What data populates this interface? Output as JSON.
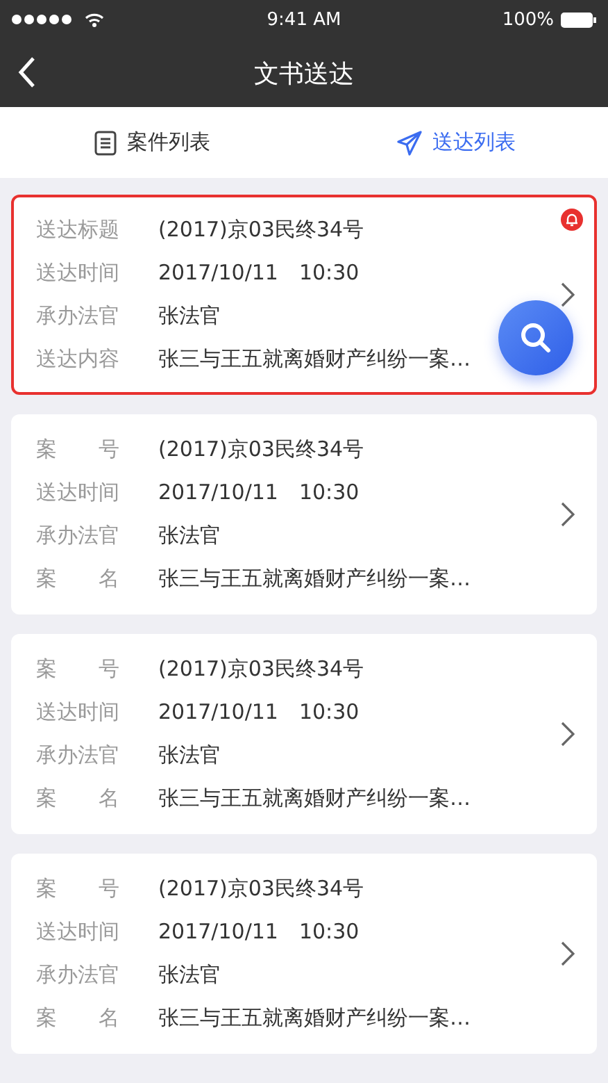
{
  "status_bar": {
    "time": "9:41 AM",
    "battery": "100%"
  },
  "nav": {
    "title": "文书送达"
  },
  "tabs": [
    {
      "label": "案件列表",
      "selected": false,
      "kind": "list"
    },
    {
      "label": "送达列表",
      "selected": true,
      "kind": "send"
    }
  ],
  "cards": [
    {
      "highlighted": true,
      "alert": true,
      "fields": [
        {
          "label": "送达标题",
          "value": "(2017)京03民终34号"
        },
        {
          "label": "送达时间",
          "value": "2017/10/11　10:30"
        },
        {
          "label": "承办法官",
          "value": "张法官"
        },
        {
          "label": "送达内容",
          "value": "张三与王五就离婚财产纠纷一案…"
        }
      ]
    },
    {
      "highlighted": false,
      "alert": false,
      "fields": [
        {
          "label": "案　　号",
          "value": "(2017)京03民终34号"
        },
        {
          "label": "送达时间",
          "value": "2017/10/11　10:30"
        },
        {
          "label": "承办法官",
          "value": "张法官"
        },
        {
          "label": "案　　名",
          "value": "张三与王五就离婚财产纠纷一案…"
        }
      ]
    },
    {
      "highlighted": false,
      "alert": false,
      "fields": [
        {
          "label": "案　　号",
          "value": "(2017)京03民终34号"
        },
        {
          "label": "送达时间",
          "value": "2017/10/11　10:30"
        },
        {
          "label": "承办法官",
          "value": "张法官"
        },
        {
          "label": "案　　名",
          "value": "张三与王五就离婚财产纠纷一案…"
        }
      ]
    },
    {
      "highlighted": false,
      "alert": false,
      "fields": [
        {
          "label": "案　　号",
          "value": "(2017)京03民终34号"
        },
        {
          "label": "送达时间",
          "value": "2017/10/11　10:30"
        },
        {
          "label": "承办法官",
          "value": "张法官"
        },
        {
          "label": "案　　名",
          "value": "张三与王五就离婚财产纠纷一案…"
        }
      ]
    }
  ]
}
